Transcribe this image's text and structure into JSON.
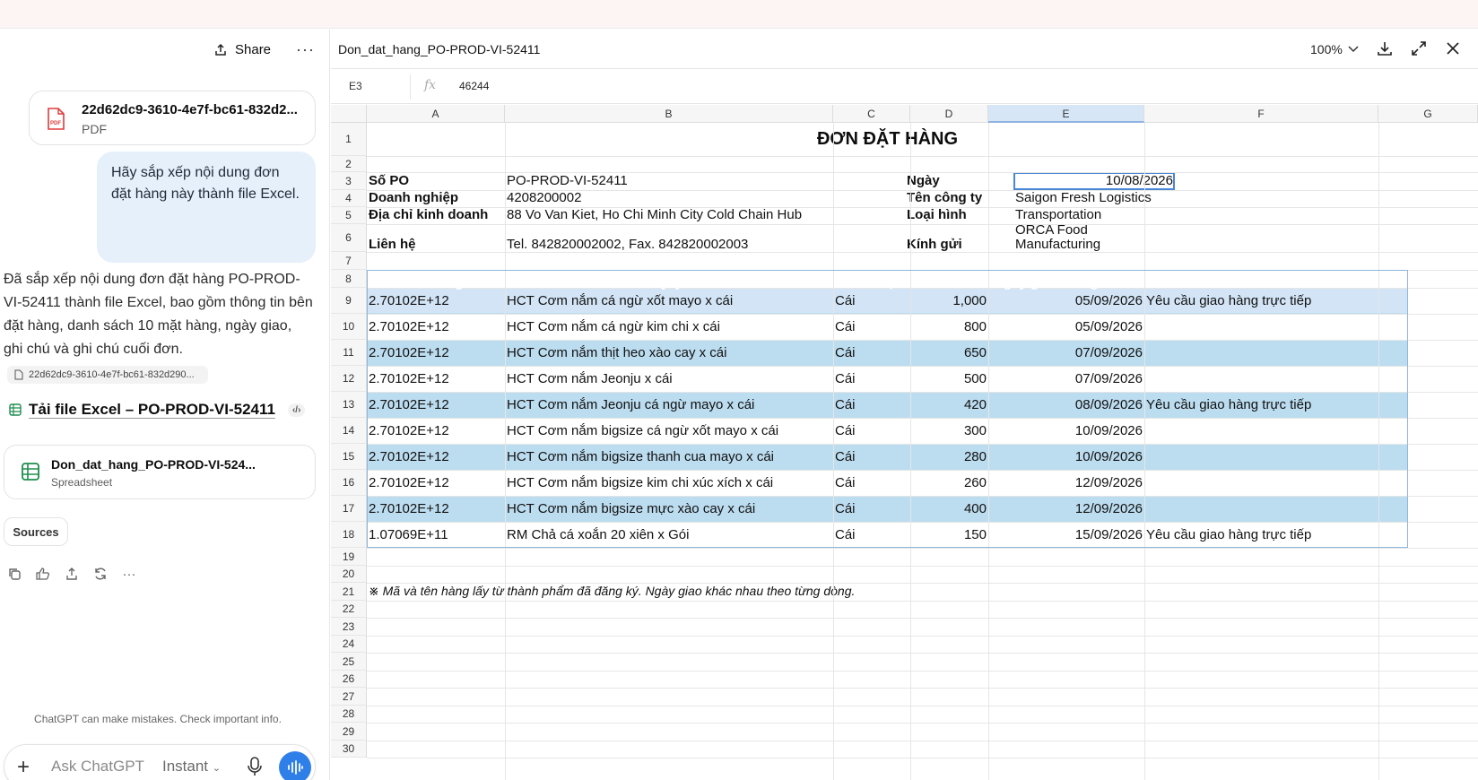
{
  "chat": {
    "share_label": "Share",
    "attachment": {
      "name": "22d62dc9-3610-4e7f-bc61-832d2...",
      "type": "PDF",
      "badge": "PDF"
    },
    "user_message": "Hãy sắp xếp nội dung đơn đặt hàng này thành file Excel.",
    "assistant_message": "Đã sắp xếp nội dung đơn đặt hàng PO-PROD-VI-52411 thành file Excel, bao gồm thông tin bên đặt hàng, danh sách 10 mặt hàng, ngày giao, ghi chú và ghi chú cuối đơn.",
    "source_chip": "22d62dc9-3610-4e7f-bc61-832d290...",
    "excel_link": "Tải file Excel – PO-PROD-VI-52411",
    "spreadsheet_card": {
      "name": "Don_dat_hang_PO-PROD-VI-524...",
      "type": "Spreadsheet"
    },
    "sources_label": "Sources",
    "disclaimer": "ChatGPT can make mistakes. Check important info.",
    "composer": {
      "placeholder": "Ask ChatGPT",
      "mode": "Instant"
    }
  },
  "sheet": {
    "doc_title": "Don_dat_hang_PO-PROD-VI-52411",
    "zoom": "100%",
    "cell_ref": "E3",
    "formula_value": "46244",
    "columns": [
      "A",
      "B",
      "C",
      "D",
      "E",
      "F",
      "G"
    ],
    "rows": [
      "1",
      "2",
      "3",
      "4",
      "5",
      "6",
      "7",
      "8",
      "9",
      "10",
      "11",
      "12",
      "13",
      "14",
      "15",
      "16",
      "17",
      "18",
      "19",
      "20",
      "21",
      "22",
      "23",
      "24",
      "25",
      "26",
      "27",
      "28",
      "29",
      "30"
    ],
    "title": "ĐƠN ĐẶT HÀNG",
    "info": {
      "po_label": "Số PO",
      "po_value": "PO-PROD-VI-52411",
      "biz_label": "Doanh nghiệp",
      "biz_value": "4208200002",
      "addr_label": "Địa chỉ kinh doanh",
      "addr_value": "88 Vo Van Kiet, Ho Chi Minh City Cold Chain Hub",
      "contact_label": "Liên hệ",
      "contact_value": "Tel. 842820002002, Fax. 842820002003",
      "date_label": "Ngày",
      "date_value": "10/08/2026",
      "company_label": "Tên công ty",
      "company_value": "Saigon Fresh Logistics",
      "kind_label": "Loại hình",
      "kind_value": "Transportation",
      "to_label": "Kính gửi",
      "to_value_1": "ORCA Food",
      "to_value_2": "Manufacturing"
    },
    "table_headers": [
      "Mã hàng",
      "Tên / Quy cách",
      "Đơn vị",
      "SL",
      "Ngày giao mong muốn",
      "Ghi chú"
    ],
    "items": [
      {
        "code": "2.70102E+12",
        "name": "HCT Cơm nắm cá ngừ xốt mayo x cái",
        "unit": "Cái",
        "qty": "1,000",
        "date": "05/09/2026",
        "note": "Yêu cầu giao hàng trực tiếp"
      },
      {
        "code": "2.70102E+12",
        "name": "HCT Cơm nắm cá ngừ kim chi x cái",
        "unit": "Cái",
        "qty": "800",
        "date": "05/09/2026",
        "note": ""
      },
      {
        "code": "2.70102E+12",
        "name": "HCT Cơm nắm thịt heo xào cay x cái",
        "unit": "Cái",
        "qty": "650",
        "date": "07/09/2026",
        "note": ""
      },
      {
        "code": "2.70102E+12",
        "name": "HCT Cơm nắm Jeonju x cái",
        "unit": "Cái",
        "qty": "500",
        "date": "07/09/2026",
        "note": ""
      },
      {
        "code": "2.70102E+12",
        "name": "HCT Cơm nắm Jeonju cá ngừ mayo x cái",
        "unit": "Cái",
        "qty": "420",
        "date": "08/09/2026",
        "note": "Yêu cầu giao hàng trực tiếp"
      },
      {
        "code": "2.70102E+12",
        "name": "HCT Cơm nắm bigsize cá ngừ xốt mayo x cái",
        "unit": "Cái",
        "qty": "300",
        "date": "10/09/2026",
        "note": ""
      },
      {
        "code": "2.70102E+12",
        "name": "HCT Cơm nắm bigsize thanh cua mayo x cái",
        "unit": "Cái",
        "qty": "280",
        "date": "10/09/2026",
        "note": ""
      },
      {
        "code": "2.70102E+12",
        "name": "HCT Cơm nắm bigsize kim chi xúc xích x cái",
        "unit": "Cái",
        "qty": "260",
        "date": "12/09/2026",
        "note": ""
      },
      {
        "code": "2.70102E+12",
        "name": "HCT Cơm nắm bigsize mực xào cay x cái",
        "unit": "Cái",
        "qty": "400",
        "date": "12/09/2026",
        "note": ""
      },
      {
        "code": "1.07069E+11",
        "name": "RM Chả cá xoắn 20 xiên x Gói",
        "unit": "Cái",
        "qty": "150",
        "date": "15/09/2026",
        "note": "Yêu cầu giao hàng trực tiếp"
      }
    ],
    "footnote": "※ Mã và tên hàng lấy từ thành phẩm đã đăng ký. Ngày giao khác nhau theo từng dòng."
  },
  "colors": {
    "accent": "#2f7fe8",
    "table_header": "#d2e4f5",
    "table_band": "#bcdcef",
    "selection": "#4a86d8"
  },
  "icons": [
    "share-icon",
    "more-icon",
    "pdf-icon",
    "file-icon",
    "spreadsheet-icon",
    "code-icon",
    "copy-icon",
    "feedback-icon",
    "export-icon",
    "regenerate-icon",
    "plus-icon",
    "chevron-down-icon",
    "mic-icon",
    "voice-icon",
    "download-icon",
    "expand-icon",
    "close-icon",
    "fx-icon"
  ]
}
